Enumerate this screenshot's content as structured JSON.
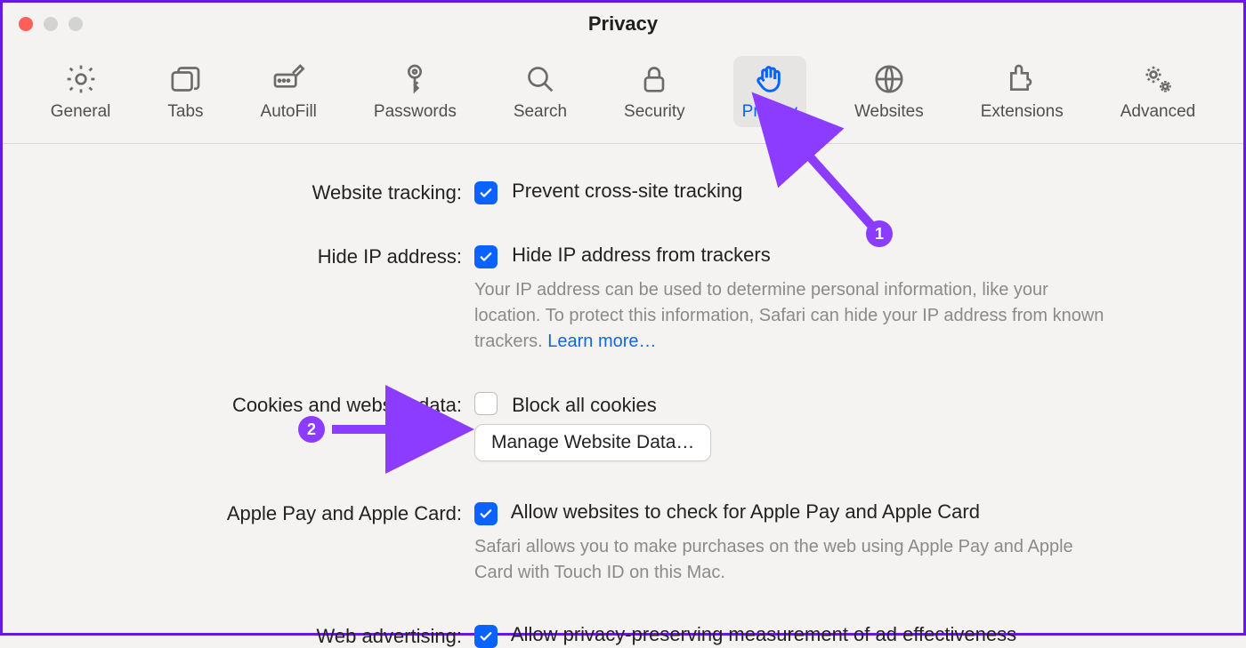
{
  "window": {
    "title": "Privacy"
  },
  "toolbar": {
    "tabs": [
      {
        "id": "general",
        "label": "General"
      },
      {
        "id": "tabs",
        "label": "Tabs"
      },
      {
        "id": "autofill",
        "label": "AutoFill"
      },
      {
        "id": "passwords",
        "label": "Passwords"
      },
      {
        "id": "search",
        "label": "Search"
      },
      {
        "id": "security",
        "label": "Security"
      },
      {
        "id": "privacy",
        "label": "Privacy"
      },
      {
        "id": "websites",
        "label": "Websites"
      },
      {
        "id": "extensions",
        "label": "Extensions"
      },
      {
        "id": "advanced",
        "label": "Advanced"
      }
    ],
    "active": "privacy"
  },
  "settings": {
    "website_tracking": {
      "label": "Website tracking:",
      "checkbox": {
        "checked": true,
        "text": "Prevent cross-site tracking"
      }
    },
    "hide_ip": {
      "label": "Hide IP address:",
      "checkbox": {
        "checked": true,
        "text": "Hide IP address from trackers"
      },
      "help": "Your IP address can be used to determine personal information, like your location. To protect this information, Safari can hide your IP address from known trackers. ",
      "learn_more": "Learn more…"
    },
    "cookies": {
      "label": "Cookies and website data:",
      "checkbox": {
        "checked": false,
        "text": "Block all cookies"
      },
      "button": "Manage Website Data…"
    },
    "apple_pay": {
      "label": "Apple Pay and Apple Card:",
      "checkbox": {
        "checked": true,
        "text": "Allow websites to check for Apple Pay and Apple Card"
      },
      "help": "Safari allows you to make purchases on the web using Apple Pay and Apple Card with Touch ID on this Mac."
    },
    "web_ads": {
      "label": "Web advertising:",
      "checkbox": {
        "checked": true,
        "text": "Allow privacy-preserving measurement of ad effectiveness"
      }
    }
  },
  "annotations": {
    "callout1": "1",
    "callout2": "2"
  }
}
